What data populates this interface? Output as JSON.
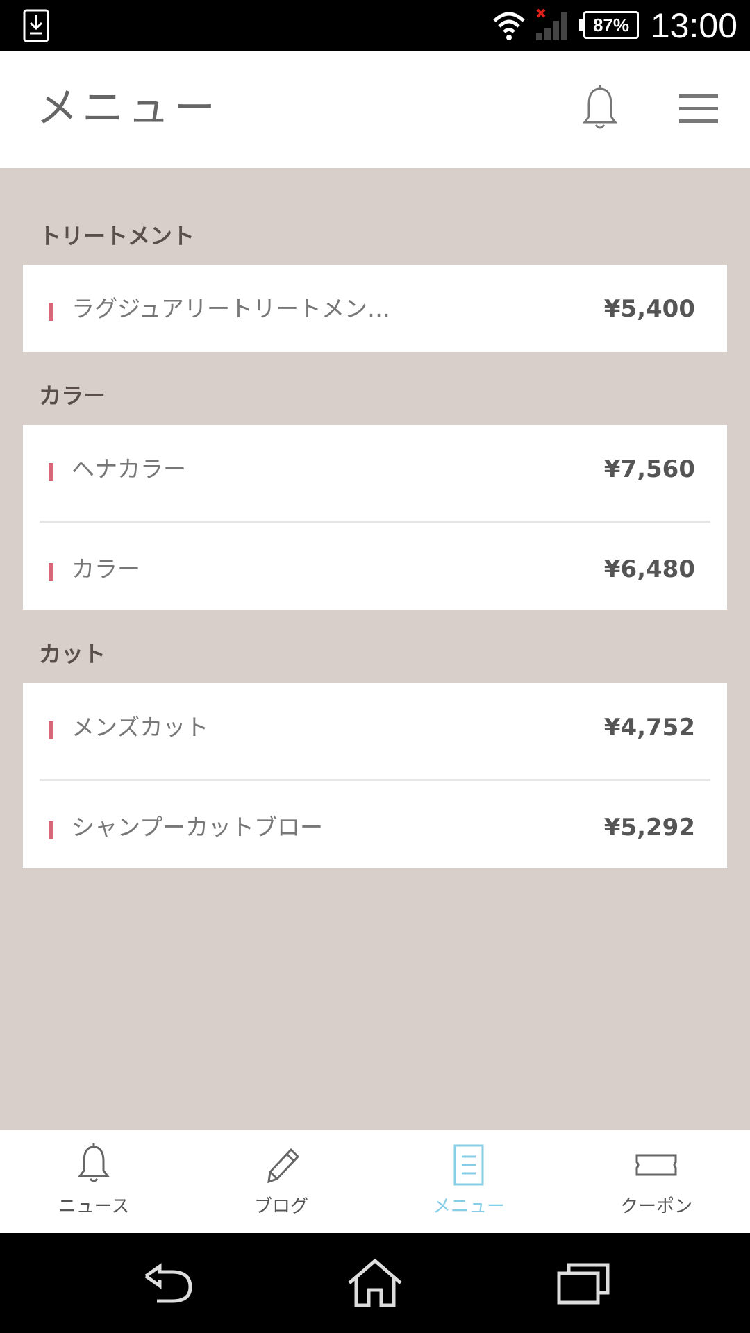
{
  "status_bar": {
    "battery": "87%",
    "time": "13:00"
  },
  "header": {
    "title": "メニュー"
  },
  "sections": [
    {
      "title": "トリートメント",
      "items": [
        {
          "name": "ラグジュアリートリートメン…",
          "price": "¥5,400"
        }
      ]
    },
    {
      "title": "カラー",
      "items": [
        {
          "name": "ヘナカラー",
          "price": "¥7,560"
        },
        {
          "name": "カラー",
          "price": "¥6,480"
        }
      ]
    },
    {
      "title": "カット",
      "items": [
        {
          "name": "メンズカット",
          "price": "¥4,752"
        },
        {
          "name": "シャンプーカットブロー",
          "price": "¥5,292"
        }
      ]
    }
  ],
  "tabs": [
    {
      "label": "ニュース",
      "icon": "bell-icon"
    },
    {
      "label": "ブログ",
      "icon": "pencil-icon"
    },
    {
      "label": "メニュー",
      "icon": "document-icon",
      "active": true
    },
    {
      "label": "クーポン",
      "icon": "ticket-icon"
    }
  ],
  "colors": {
    "background": "#d8ceca",
    "accent_bar": "#d9667a",
    "active_tab": "#86cde6"
  }
}
